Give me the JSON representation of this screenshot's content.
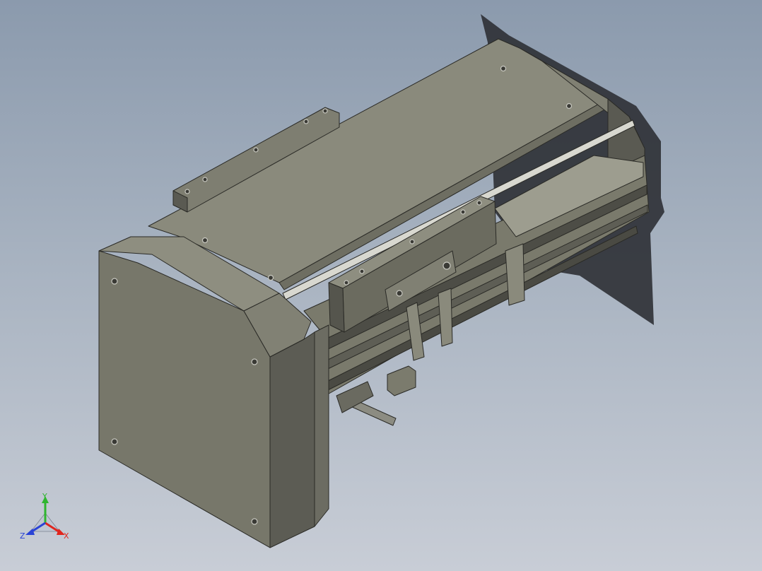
{
  "viewport": {
    "background_top": "#8b9aad",
    "background_bottom": "#c8cdd6"
  },
  "model": {
    "face_color": "#7b7b6d",
    "dark_face_color": "#5a5a52",
    "top_face_color": "#8a8a7c",
    "edge_color": "#2a2a26",
    "shadow_color": "#2d3035"
  },
  "triad": {
    "x_label": "X",
    "y_label": "Y",
    "z_label": "Z",
    "x_color": "#e0261e",
    "y_color": "#2fb52f",
    "z_color": "#2a43d6"
  }
}
